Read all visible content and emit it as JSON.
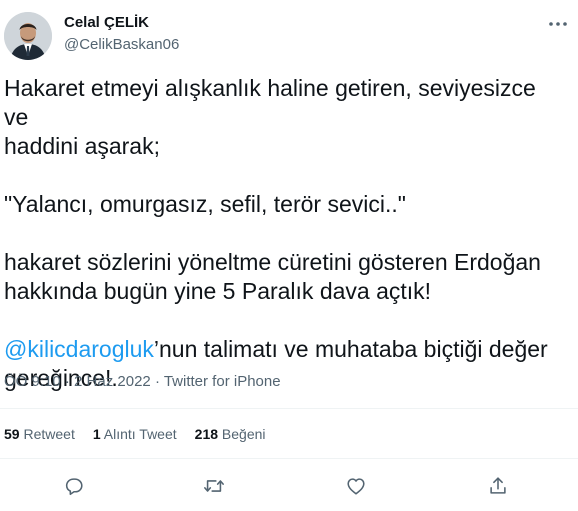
{
  "author": {
    "name": "Celal ÇELİK",
    "handle": "@CelikBaskan06"
  },
  "tweet": {
    "text_part1": "Hakaret etmeyi alışkanlık haline getiren, seviyesizce ve\nhaddini aşarak;\n\n\"Yalancı, omurgasız, sefil, terör sevici..\"\n\nhakaret sözlerini yöneltme cüretini gösteren Erdoğan\nhakkında bugün yine 5 Paralık dava açtık!\n\n",
    "mention": "@kilicdarogluk",
    "text_part2": "’nun talimatı ve muhataba biçtiği değer\ngereğince!."
  },
  "meta": {
    "time": "ÖÖ 9:10",
    "separator1": " · ",
    "date": "2 Haz 2022",
    "separator2": " · ",
    "source": "Twitter for iPhone"
  },
  "stats": {
    "retweets_count": "59",
    "retweets_label": "Retweet",
    "quotes_count": "1",
    "quotes_label": "Alıntı Tweet",
    "likes_count": "218",
    "likes_label": "Beğeni"
  },
  "icons": {
    "reply": "reply-icon",
    "retweet": "retweet-icon",
    "like": "like-icon",
    "share": "share-icon",
    "more": "more-icon"
  },
  "colors": {
    "text": "#0f1419",
    "secondary": "#536471",
    "link": "#1d9bf0",
    "divider": "#eff3f4"
  }
}
